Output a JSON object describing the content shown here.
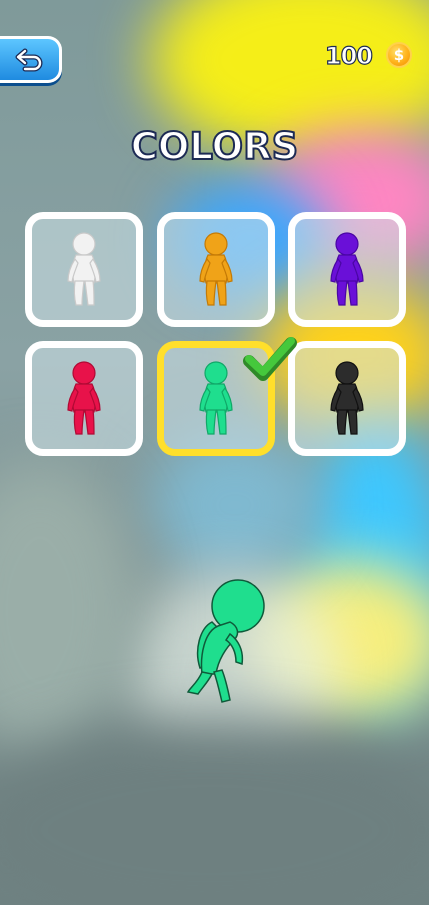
{
  "header": {
    "coins": "100",
    "back_icon": "undo-arrow-icon",
    "coin_icon": "coin-icon"
  },
  "title": "COLORS",
  "colors": [
    {
      "name": "white",
      "hex": "#f2f2f2",
      "shade": "#c9c9c9"
    },
    {
      "name": "orange",
      "hex": "#f0a318",
      "shade": "#c47a06"
    },
    {
      "name": "purple",
      "hex": "#6a10d8",
      "shade": "#4a06a4"
    },
    {
      "name": "red",
      "hex": "#e8124a",
      "shade": "#b00a34"
    },
    {
      "name": "green",
      "hex": "#1fde8e",
      "shade": "#10a868"
    },
    {
      "name": "black",
      "hex": "#2c2c2c",
      "shade": "#111111"
    }
  ],
  "selected_index": 4,
  "accent_selected": "#ffdf2b",
  "check_color": "#45c83c",
  "preview_color": "#1fde8e"
}
